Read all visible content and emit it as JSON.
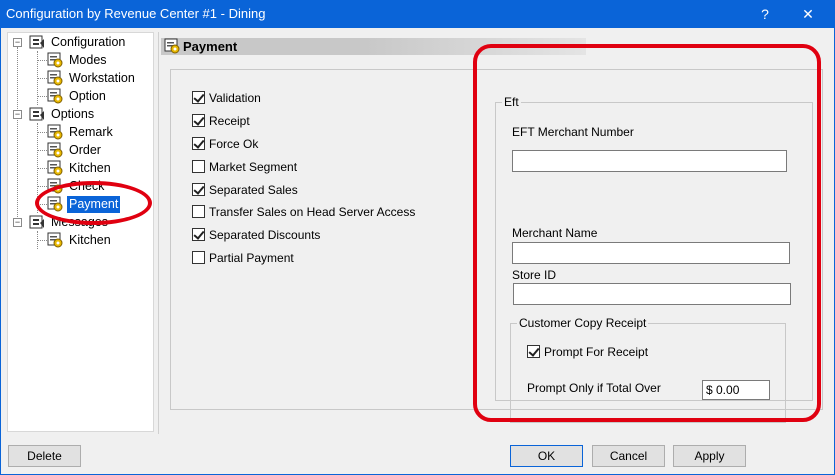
{
  "window": {
    "title": "Configuration by Revenue Center #1 - Dining",
    "help_glyph": "?",
    "close_glyph": "✕"
  },
  "tree": {
    "configuration": "Configuration",
    "modes": "Modes",
    "workstation": "Workstation",
    "option": "Option",
    "options": "Options",
    "remark": "Remark",
    "order": "Order",
    "kitchen": "Kitchen",
    "check": "Check",
    "payment": "Payment",
    "messages": "Messages",
    "msg_kitchen": "Kitchen",
    "expander_minus": "−",
    "icon": "tree-config-icon"
  },
  "section": {
    "title": "Payment"
  },
  "options": [
    {
      "label": "Validation",
      "checked": true
    },
    {
      "label": "Receipt",
      "checked": true
    },
    {
      "label": "Force Ok",
      "checked": true
    },
    {
      "label": "Market Segment",
      "checked": false
    },
    {
      "label": "Separated Sales",
      "checked": true
    },
    {
      "label": "Transfer Sales on Head Server Access",
      "checked": false
    },
    {
      "label": "Separated Discounts",
      "checked": true
    },
    {
      "label": "Partial Payment",
      "checked": false
    }
  ],
  "eft": {
    "caption": "Eft",
    "merchant_number_label": "EFT Merchant Number",
    "merchant_number_value": "",
    "merchant_name_label": "Merchant Name",
    "merchant_name_value": "",
    "store_id_label": "Store ID",
    "store_id_value": "",
    "customer_copy": {
      "caption": "Customer Copy Receipt",
      "prompt_label": "Prompt For Receipt",
      "prompt_checked": true,
      "total_over_label": "Prompt Only if Total Over",
      "total_over_value": "$ 0.00"
    }
  },
  "buttons": {
    "delete": "Delete",
    "ok": "OK",
    "cancel": "Cancel",
    "apply": "Apply"
  },
  "colors": {
    "accent": "#0a64d8",
    "highlight_ring": "#e00010"
  }
}
